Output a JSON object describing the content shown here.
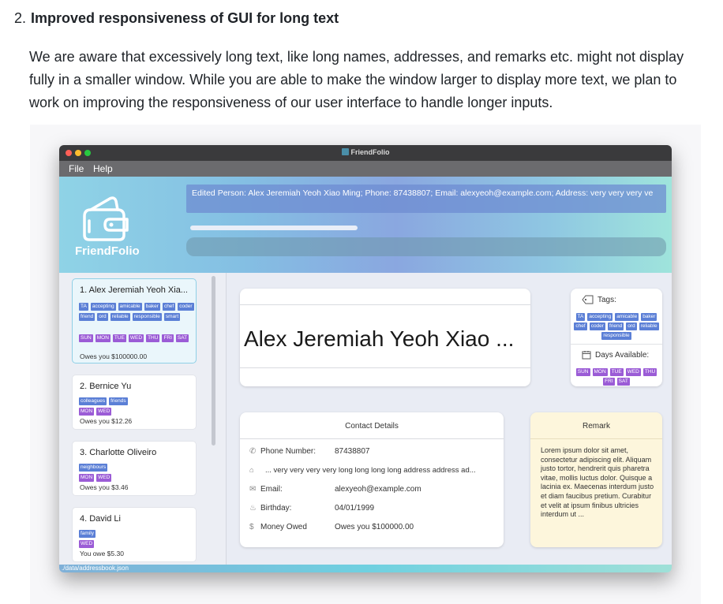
{
  "section": {
    "number": "2.",
    "title": "Improved responsiveness of GUI for long text",
    "paragraph": "We are aware that excessively long text, like long names, addresses, and remarks etc. might not display fully in a smaller window. While you are able to make the window larger to display more text, we plan to work on improving the responsiveness of our user interface to handle longer inputs."
  },
  "app": {
    "window_title": "FriendFolio",
    "menu": [
      "File",
      "Help"
    ],
    "logo_text": "FriendFolio",
    "result_text": "Edited Person: Alex Jeremiah Yeoh Xiao Ming; Phone: 87438807; Email: alexyeoh@example.com; Address: very very very ve",
    "status_path": "./data/addressbook.json",
    "people": [
      {
        "name": "1.  Alex Jeremiah Yeoh Xia...",
        "tags": [
          "TA",
          "accepting",
          "amicable",
          "baker",
          "chef",
          "coder",
          "friend",
          "ord",
          "reliable",
          "responsible",
          "smart"
        ],
        "days": [
          "SUN",
          "MON",
          "TUE",
          "WED",
          "THU",
          "FRI",
          "SAT"
        ],
        "owes": "Owes you $100000.00"
      },
      {
        "name": "2.  Bernice  Yu",
        "tags": [
          "colleagues",
          "friends"
        ],
        "days": [
          "MON",
          "WED"
        ],
        "owes": "Owes you $12.26"
      },
      {
        "name": "3.  Charlotte Oliveiro",
        "tags": [
          "neighbours"
        ],
        "days": [
          "MON",
          "WED"
        ],
        "owes": "Owes you $3.46"
      },
      {
        "name": "4.  David Li",
        "tags": [
          "family"
        ],
        "days": [
          "WED"
        ],
        "owes": "You owe $5.30"
      }
    ],
    "detail": {
      "name": "Alex Jeremiah Yeoh Xiao ...",
      "tags_label": "Tags:",
      "tags": [
        "TA",
        "accepting",
        "amicable",
        "baker",
        "chef",
        "coder",
        "friend",
        "ord",
        "reliable",
        "responsible"
      ],
      "days_label": "Days Available:",
      "days": [
        "SUN",
        "MON",
        "TUE",
        "WED",
        "THU",
        "FRI",
        "SAT"
      ],
      "contact_title": "Contact Details",
      "phone_label": "Phone Number:",
      "phone": "87438807",
      "address": "...  very very very very long long long long address address ad...",
      "email_label": "Email:",
      "email": "alexyeoh@example.com",
      "birthday_label": "Birthday:",
      "birthday": "04/01/1999",
      "money_label": "Money Owed",
      "money": "Owes you $100000.00",
      "remark_title": "Remark",
      "remark": "Lorem ipsum dolor sit amet, consectetur adipiscing elit. Aliquam justo tortor, hendrerit quis pharetra vitae, mollis luctus dolor. Quisque a lacinia ex. Maecenas interdum justo et diam faucibus pretium. Curabitur et velit at ipsum finibus ultricies interdum ut ..."
    }
  }
}
